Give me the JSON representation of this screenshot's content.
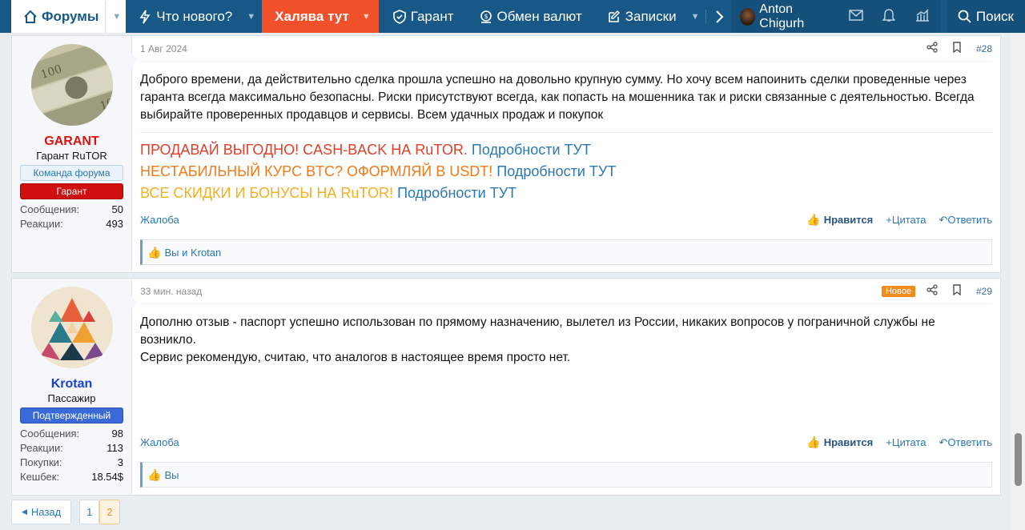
{
  "nav": {
    "forums": "Форумы",
    "whats_new": "Что нового?",
    "halyava": "Халява тут",
    "garant": "Гарант",
    "exchange": "Обмен валют",
    "notes": "Записки",
    "user": "Anton Chigurh",
    "search": "Поиск"
  },
  "colors": {
    "nav_bg": "#185886",
    "halyava_bg": "#f0502a",
    "sig_red": "#e0402a",
    "sig_orange": "#f07a1a",
    "sig_yellow": "#f0b020",
    "link": "#2a78b4"
  },
  "posts": [
    {
      "username": "GARANT",
      "user_title": "Гарант RuTOR",
      "badges": [
        "Команда форума",
        "Гарант"
      ],
      "stats": [
        {
          "label": "Сообщения:",
          "value": "50"
        },
        {
          "label": "Реакции:",
          "value": "493"
        }
      ],
      "date": "1 Авг 2024",
      "number": "#28",
      "body": "Доброго времени, да действительно сделка прошла успешно на довольно крупную сумму. Но хочу всем напоинить сделки проведенные через гаранта всегда максимально безопасны. Риски присутствуют всегда, как попасть на мошенника так и риски связанные с деятельностью. Всегда выбирайте проверенных продавцов и сервисы. Всем удачных продаж и покупок",
      "signature": [
        {
          "text": "ПРОДАВАЙ ВЫГОДНО! CASH-BACK НА RuTOR.",
          "link": "Подробности ТУТ"
        },
        {
          "text": "НЕСТАБИЛЬНЫЙ КУРС BTC? ОФОРМЛЯЙ В USDT!",
          "link": "Подробности ТУТ"
        },
        {
          "text": "ВСЕ СКИДКИ И БОНУСЫ НА RuTOR!",
          "link": "Подробности ТУТ"
        }
      ],
      "report": "Жалоба",
      "like": "Нравится",
      "quote": "Цитата",
      "reply": "Ответить",
      "reactions": "Вы и Krotan"
    },
    {
      "username": "Krotan",
      "user_title": "Пассажир",
      "badges": [
        "Подтвержденный"
      ],
      "stats": [
        {
          "label": "Сообщения:",
          "value": "98"
        },
        {
          "label": "Реакции:",
          "value": "113"
        },
        {
          "label": "Покупки:",
          "value": "3"
        },
        {
          "label": "Кешбек:",
          "value": "18.54$"
        }
      ],
      "date": "33 мин. назад",
      "new_tag": "Новое",
      "number": "#29",
      "body_lines": [
        "Дополню отзыв - паспорт успешно использован по прямому назначению, вылетел из России, никаких вопросов у пограничной службы не возникло.",
        "Сервис рекомендую, считаю, что аналогов в настоящее время просто нет."
      ],
      "report": "Жалоба",
      "like": "Нравится",
      "quote": "Цитата",
      "reply": "Ответить",
      "reactions": "Вы"
    }
  ],
  "pagination": {
    "back": "Назад",
    "pages": [
      "1",
      "2"
    ],
    "current": "2"
  }
}
